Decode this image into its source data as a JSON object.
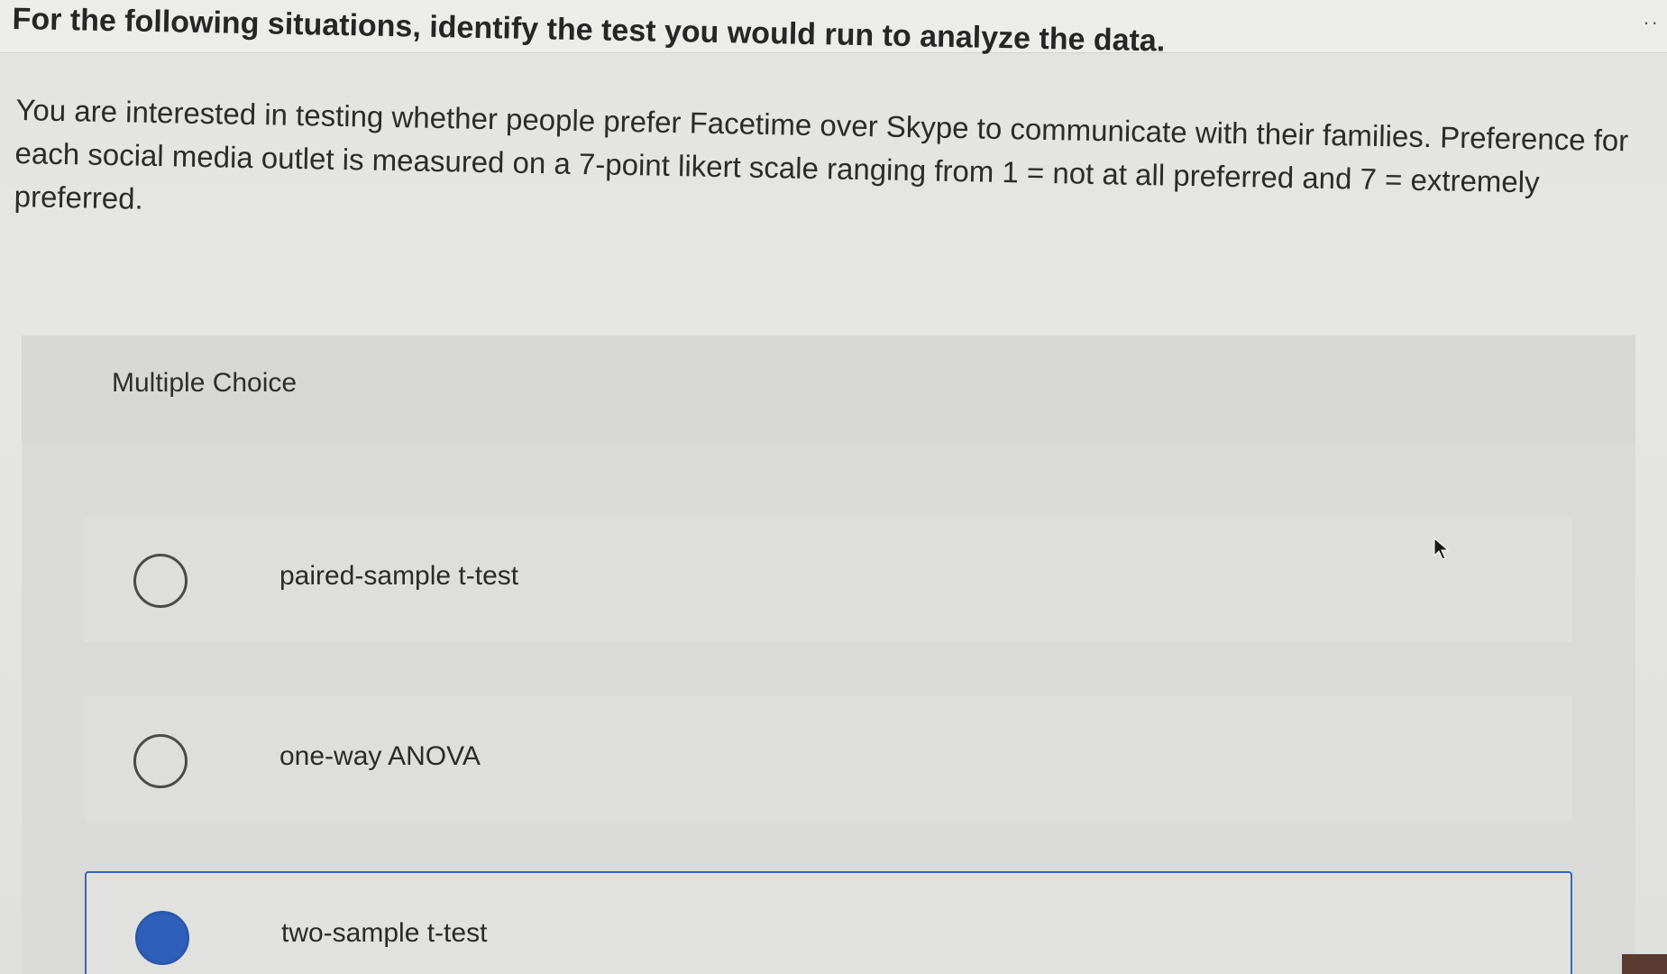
{
  "header": {
    "instruction": "For the following situations, identify the test you would run to analyze the data.",
    "menu_icon": "more-dots-icon"
  },
  "question": {
    "text": "You are interested in testing whether people prefer Facetime over Skype to communicate with their families. Preference for each social media outlet is measured on a 7-point likert scale ranging from 1 = not at all preferred and 7 = extremely preferred."
  },
  "multiple_choice": {
    "title": "Multiple Choice",
    "options": [
      {
        "label": "paired-sample t-test",
        "selected": false
      },
      {
        "label": "one-way ANOVA",
        "selected": false
      },
      {
        "label": "two-sample t-test",
        "selected": true
      }
    ],
    "selected_color": "#2e5fba"
  }
}
